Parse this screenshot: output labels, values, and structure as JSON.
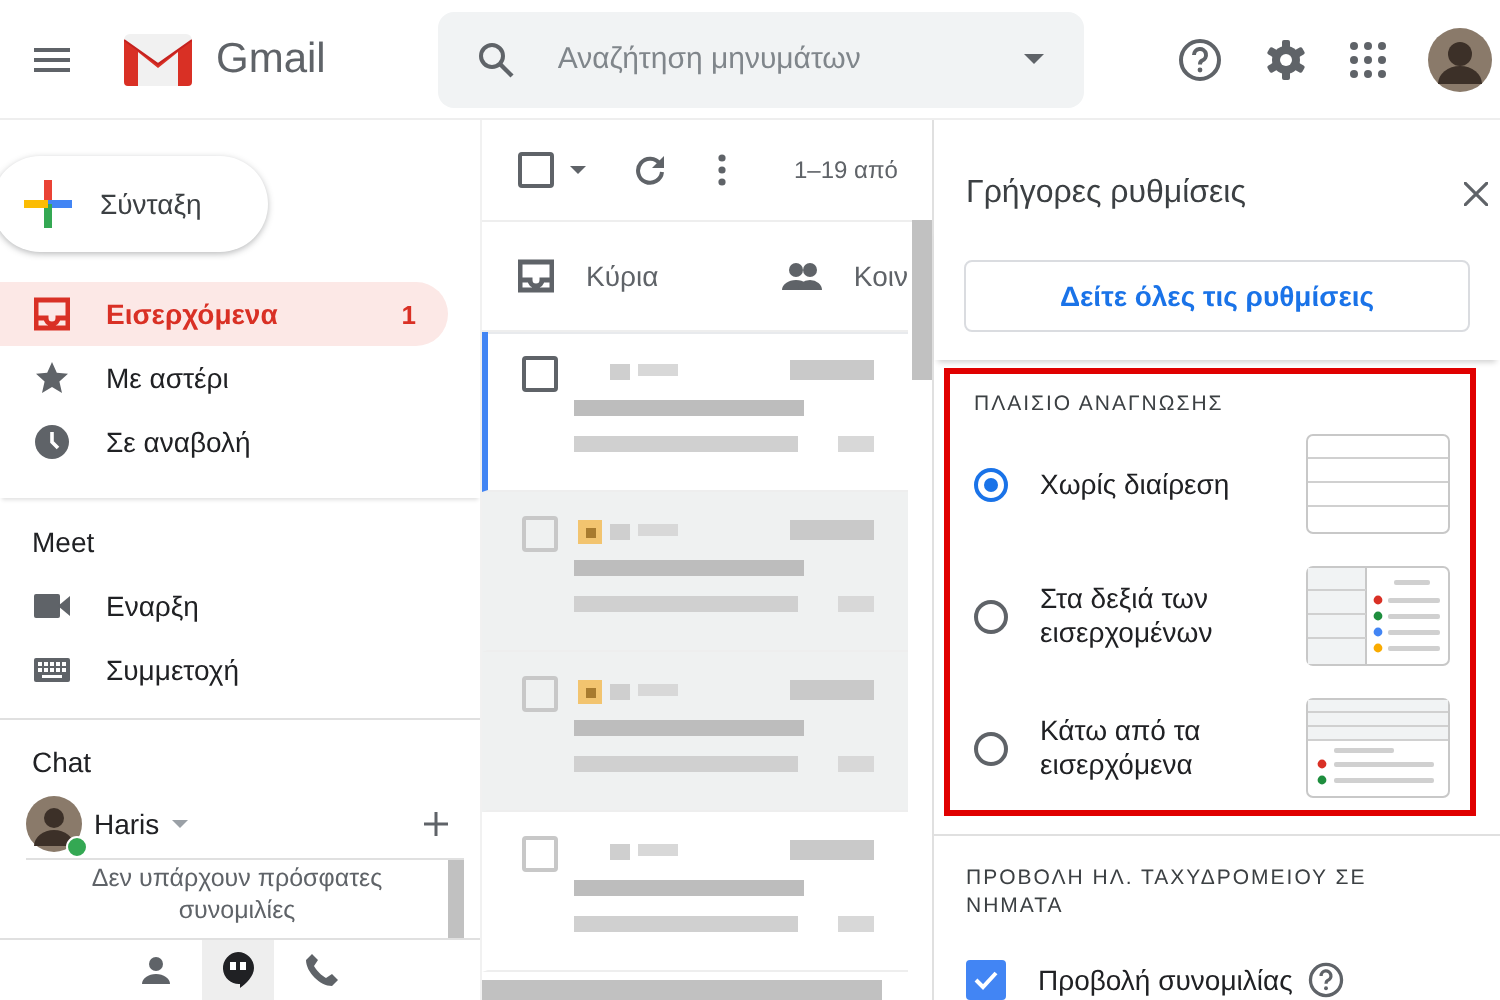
{
  "header": {
    "app_name": "Gmail",
    "search": {
      "placeholder": "Αναζήτηση μηνυμάτων"
    }
  },
  "sidebar": {
    "compose": "Σύνταξη",
    "items": [
      {
        "label": "Εισερχόμενα",
        "count": "1",
        "selected": true
      },
      {
        "label": "Με αστέρι",
        "selected": false
      },
      {
        "label": "Σε αναβολή",
        "selected": false
      }
    ],
    "meet": {
      "title": "Meet",
      "items": [
        {
          "label": "Εναρξη"
        },
        {
          "label": "Συμμετοχή"
        }
      ]
    },
    "chat": {
      "title": "Chat",
      "user": "Haris",
      "online": true,
      "empty_text": "Δεν υπάρχουν πρόσφατες συνομιλίες"
    }
  },
  "mail_list": {
    "select_all": {
      "checked": false
    },
    "range": "1–19 από",
    "tabs": [
      {
        "label": "Κύρια"
      },
      {
        "label": "Κοιν"
      }
    ],
    "rows": [
      {
        "read": false,
        "focused": true,
        "important": false
      },
      {
        "read": true,
        "focused": false,
        "important": true
      },
      {
        "read": true,
        "focused": false,
        "important": true
      },
      {
        "read": false,
        "focused": false,
        "important": false
      }
    ]
  },
  "quick_settings": {
    "title": "Γρήγορες ρυθμίσεις",
    "all_settings": "Δείτε όλες τις ρυθμίσεις",
    "reading_pane": {
      "title": "ΠΛΑΙΣΙΟ ΑΝΑΓΝΩΣΗΣ",
      "highlighted": true,
      "options": [
        {
          "label": "Χωρίς διαίρεση",
          "kind": "none",
          "selected": true
        },
        {
          "label": "Στα δεξιά των εισερχομένων",
          "kind": "right",
          "selected": false
        },
        {
          "label": "Κάτω από τα εισερχόμενα",
          "kind": "below",
          "selected": false
        }
      ]
    },
    "threading": {
      "title": "ΠΡΟΒΟΛΗ ΗΛ. ΤΑΧΥΔΡΟΜΕΙΟΥ ΣΕ ΝΗΜΑΤΑ",
      "option": {
        "label": "Προβολή συνομιλίας",
        "checked": true
      }
    }
  }
}
